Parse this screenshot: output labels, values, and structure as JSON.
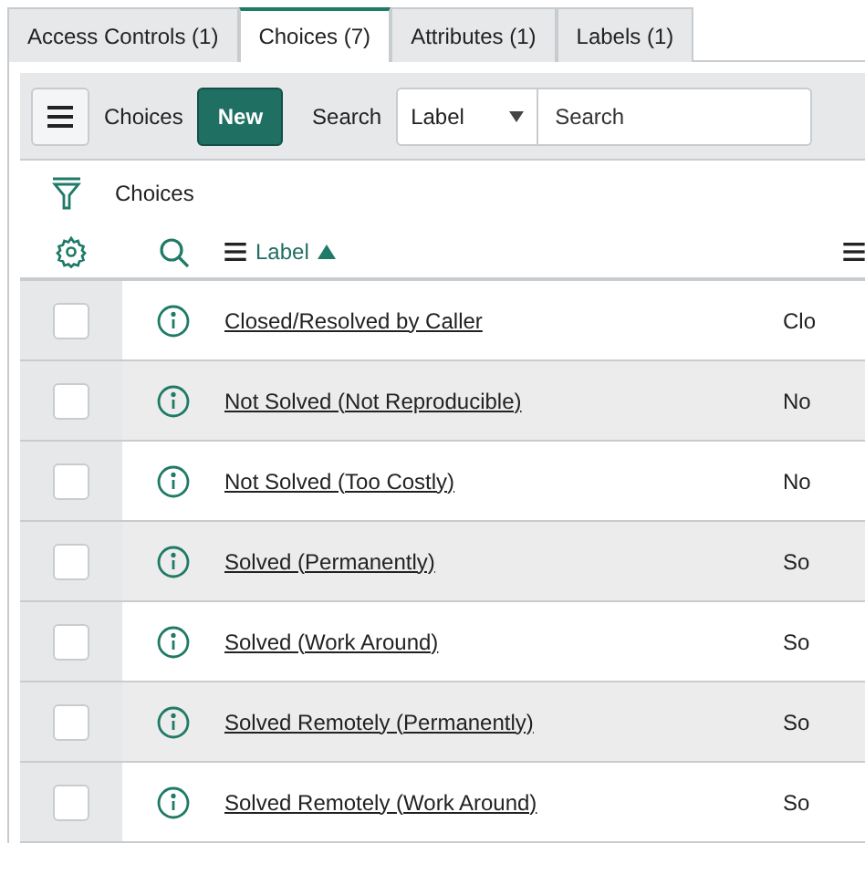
{
  "tabs": [
    {
      "label": "Access Controls (1)",
      "selected": false
    },
    {
      "label": "Choices (7)",
      "selected": true
    },
    {
      "label": "Attributes (1)",
      "selected": false
    },
    {
      "label": "Labels (1)",
      "selected": false
    }
  ],
  "toolbar": {
    "title": "Choices",
    "new_button": "New",
    "search_label": "Search",
    "field_select": "Label",
    "search": {
      "placeholder": "Search"
    }
  },
  "filter": {
    "label": "Choices"
  },
  "table": {
    "columns": [
      {
        "label": "Label",
        "sorted_ascending": true
      }
    ],
    "rows": [
      {
        "checked": false,
        "label": "Closed/Resolved by Caller",
        "column_3": "Clo"
      },
      {
        "checked": false,
        "label": "Not Solved (Not Reproducible)",
        "column_3": "No"
      },
      {
        "checked": false,
        "label": "Not Solved (Too Costly)",
        "column_3": "No"
      },
      {
        "checked": false,
        "label": "Solved (Permanently)",
        "column_3": "So"
      },
      {
        "checked": false,
        "label": "Solved (Work Around)",
        "column_3": "So"
      },
      {
        "checked": false,
        "label": "Solved Remotely (Permanently)",
        "column_3": "So"
      },
      {
        "checked": false,
        "label": "Solved Remotely (Work Around)",
        "column_3": "So"
      }
    ]
  }
}
